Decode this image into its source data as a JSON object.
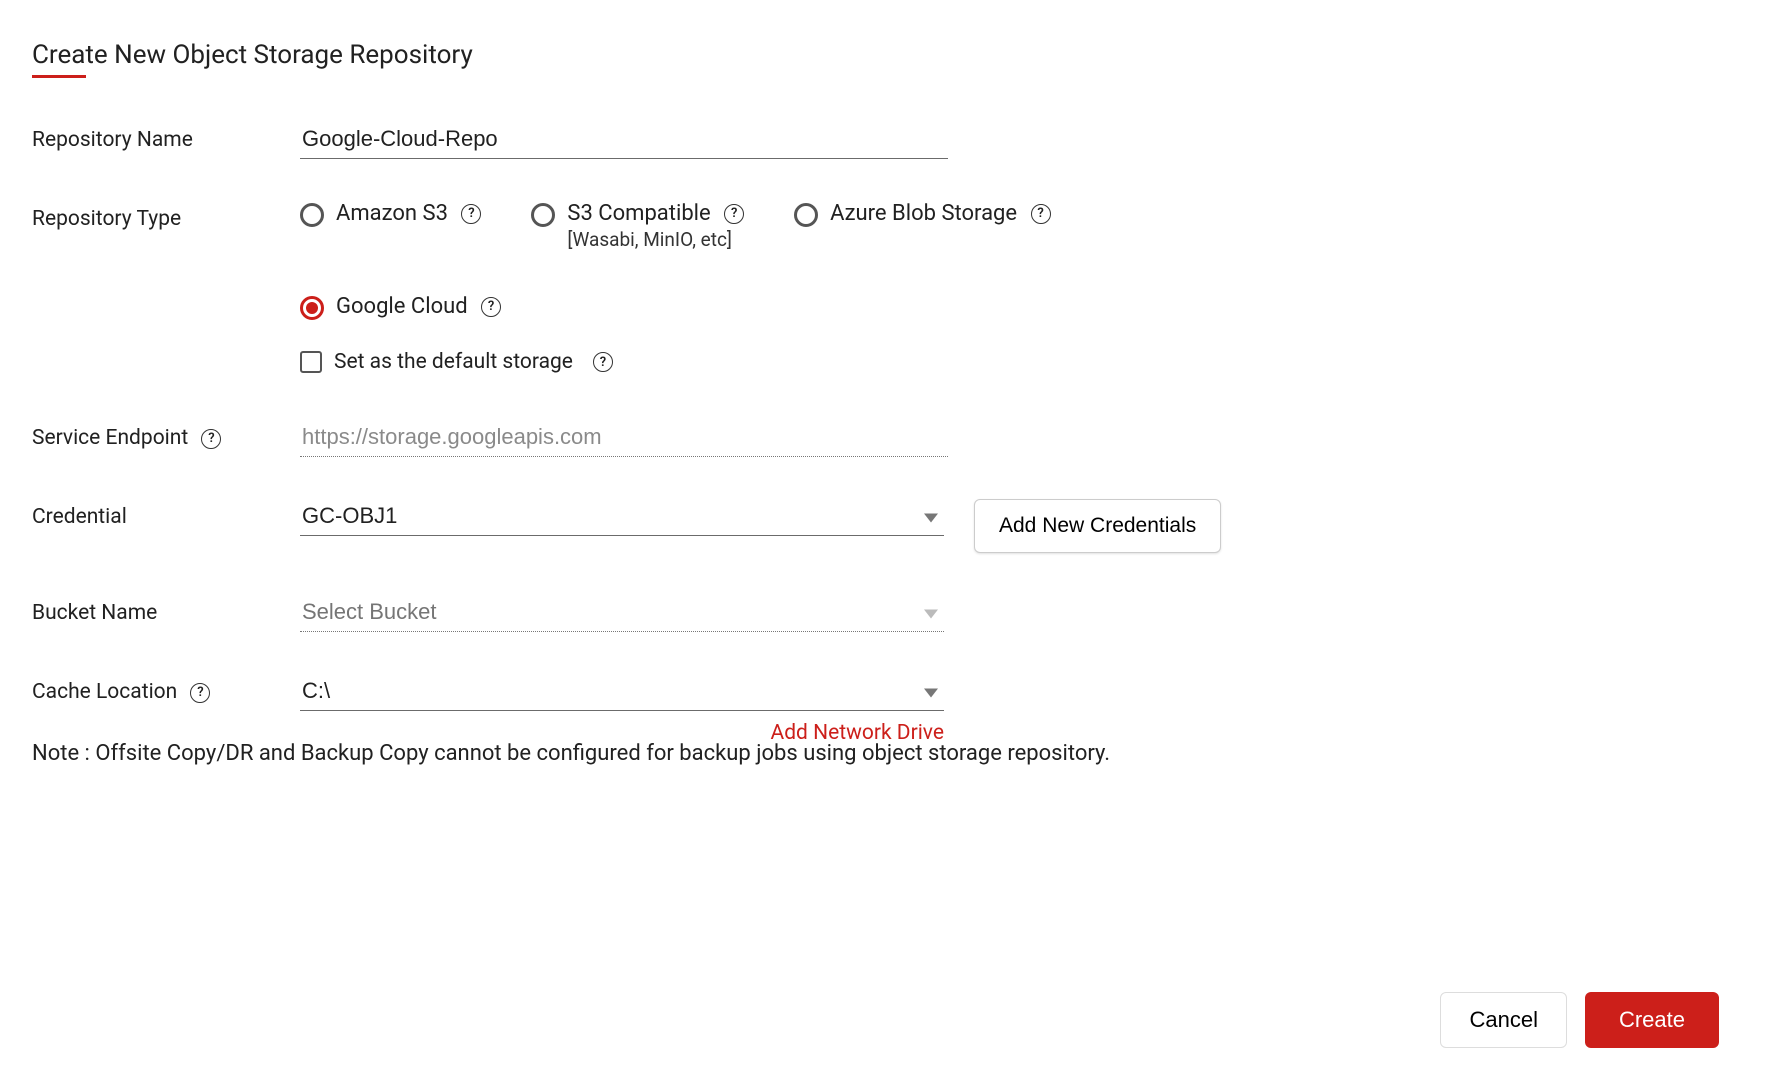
{
  "title": "Create New Object Storage Repository",
  "labels": {
    "repository_name": "Repository Name",
    "repository_type": "Repository Type",
    "default_storage": "Set as the default storage",
    "service_endpoint": "Service Endpoint",
    "credential": "Credential",
    "bucket_name": "Bucket Name",
    "cache_location": "Cache Location"
  },
  "values": {
    "repository_name": "Google-Cloud-Repo",
    "service_endpoint": "https://storage.googleapis.com",
    "credential": "GC-OBJ1",
    "bucket_placeholder": "Select Bucket",
    "cache_location": "C:\\"
  },
  "repository_types": {
    "amazon_s3": "Amazon S3",
    "s3_compatible": "S3 Compatible",
    "s3_compatible_sub": "[Wasabi, MinIO, etc]",
    "azure": "Azure Blob Storage",
    "google": "Google Cloud"
  },
  "buttons": {
    "add_credentials": "Add New Credentials",
    "add_network_drive": "Add Network Drive",
    "cancel": "Cancel",
    "create": "Create"
  },
  "note": "Note : Offsite Copy/DR and Backup Copy cannot be configured for backup jobs using object storage repository.",
  "help": "?"
}
